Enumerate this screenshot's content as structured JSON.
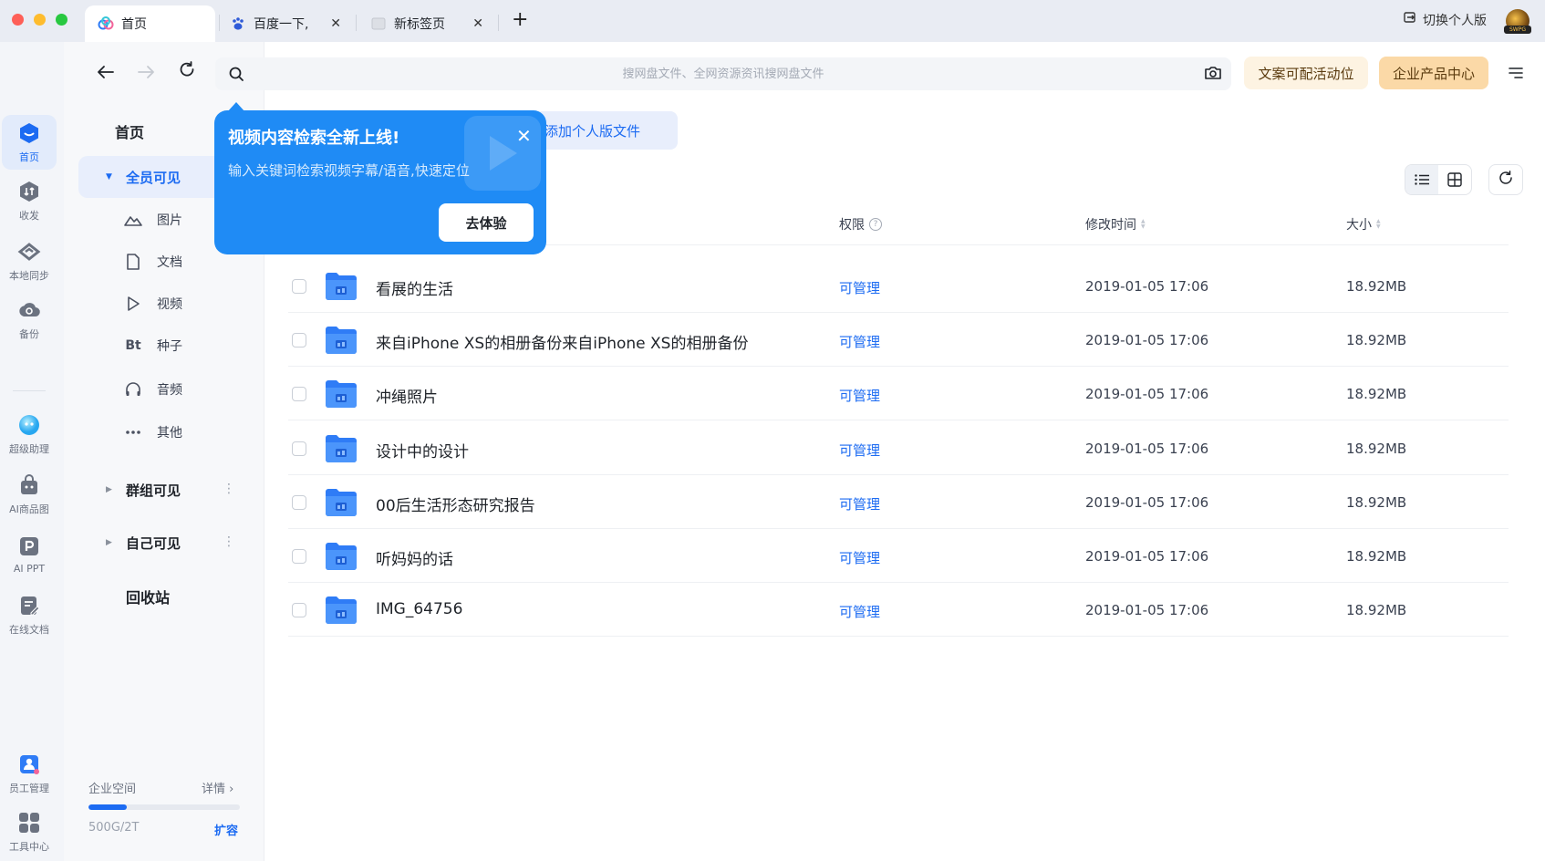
{
  "tabs": [
    {
      "label": "首页",
      "active": true
    },
    {
      "label": "百度一下,",
      "active": false
    },
    {
      "label": "新标签页",
      "active": false
    }
  ],
  "titlebar": {
    "switch_label": "切换个人版",
    "avatar_badge": "SWPG"
  },
  "search": {
    "placeholder": "搜网盘文件、全网资源资讯搜网盘文件"
  },
  "promos": {
    "copy_slot": "文案可配活动位",
    "enterprise_center": "企业产品中心"
  },
  "rail": [
    {
      "label": "首页",
      "icon": "cloud-home-icon",
      "active": true
    },
    {
      "label": "收发",
      "icon": "transfer-icon"
    },
    {
      "label": "本地同步",
      "icon": "sync-icon"
    },
    {
      "label": "备份",
      "icon": "backup-icon"
    },
    {
      "label": "超级助理",
      "icon": "assistant-icon"
    },
    {
      "label": "AI商品图",
      "icon": "ai-product-icon"
    },
    {
      "label": "AI PPT",
      "icon": "ai-ppt-icon"
    },
    {
      "label": "在线文档",
      "icon": "online-doc-icon"
    },
    {
      "label": "员工管理",
      "icon": "staff-icon"
    },
    {
      "label": "工具中心",
      "icon": "tools-icon"
    }
  ],
  "sidebar": {
    "home": "首页",
    "all_visible": "全员可见",
    "sub_items": [
      "图片",
      "文档",
      "视频",
      "种子",
      "音频",
      "其他"
    ],
    "seed_prefix": "Bt",
    "group_visible": "群组可见",
    "self_visible": "自己可见",
    "recycle": "回收站"
  },
  "storage": {
    "label": "企业空间",
    "detail": "详情",
    "used": "500G/2T",
    "fraction": 0.25,
    "expand": "扩容"
  },
  "content": {
    "add_personal": "添加个人版文件"
  },
  "table": {
    "headers": {
      "permission": "权限",
      "modified": "修改时间",
      "size": "大小"
    },
    "rows": [
      {
        "name": "看展的生活",
        "permission": "可管理",
        "modified": "2019-01-05 17:06",
        "size": "18.92MB"
      },
      {
        "name": "来自iPhone XS的相册备份来自iPhone XS的相册备份",
        "permission": "可管理",
        "modified": "2019-01-05 17:06",
        "size": "18.92MB"
      },
      {
        "name": "冲绳照片",
        "permission": "可管理",
        "modified": "2019-01-05 17:06",
        "size": "18.92MB"
      },
      {
        "name": "设计中的设计",
        "permission": "可管理",
        "modified": "2019-01-05 17:06",
        "size": "18.92MB"
      },
      {
        "name": "00后生活形态研究报告",
        "permission": "可管理",
        "modified": "2019-01-05 17:06",
        "size": "18.92MB"
      },
      {
        "name": "听妈妈的话",
        "permission": "可管理",
        "modified": "2019-01-05 17:06",
        "size": "18.92MB"
      },
      {
        "name": "IMG_64756",
        "permission": "可管理",
        "modified": "2019-01-05 17:06",
        "size": "18.92MB"
      }
    ]
  },
  "popover": {
    "title": "视频内容检索全新上线!",
    "desc": "输入关键词检索视频字幕/语音,快速定位",
    "button": "去体验"
  },
  "colors": {
    "accent": "#1c6bf2",
    "popover": "#1f8bf5",
    "promo_light": "#fdf3e2",
    "promo_dark": "#fbd9a7"
  }
}
